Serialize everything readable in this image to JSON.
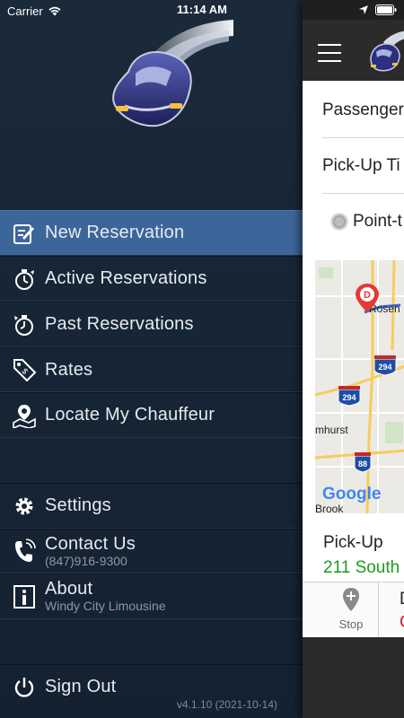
{
  "status_bar": {
    "carrier": "Carrier",
    "time": "11:14 AM"
  },
  "drawer": {
    "menu": [
      {
        "label": "New Reservation",
        "icon": "new-reservation-icon",
        "active": true
      },
      {
        "label": "Active Reservations",
        "icon": "stopwatch-icon"
      },
      {
        "label": "Past Reservations",
        "icon": "history-icon"
      },
      {
        "label": "Rates",
        "icon": "price-tag-icon"
      },
      {
        "label": "Locate My Chauffeur",
        "icon": "map-pin-icon"
      }
    ],
    "settings": {
      "label": "Settings",
      "icon": "gear-icon"
    },
    "contact": {
      "label": "Contact Us",
      "sub": "(847)916-9300",
      "icon": "phone-icon"
    },
    "about": {
      "label": "About",
      "sub": "Windy City Limousine",
      "icon": "info-icon"
    },
    "sign_out": {
      "label": "Sign Out",
      "icon": "power-icon"
    },
    "version": "v4.1.10 (2021-10-14)"
  },
  "main": {
    "field_passenger": "Passenger",
    "field_pickup_time": "Pick-Up Ti",
    "radio_label": "Point-t",
    "map": {
      "marker_letter": "D",
      "labels": [
        "Rosen",
        "mhurst",
        "Brook"
      ],
      "shields": [
        "294",
        "294",
        "88"
      ],
      "attribution": "Google"
    },
    "pickup_label": "Pick-Up",
    "pickup_address": "211 South",
    "stop_label": "Stop",
    "d_top": "D",
    "d_bottom": "C"
  },
  "colors": {
    "accent": "#3c6699",
    "drawer_bg": "#172636",
    "pickup_green": "#1f9a1f",
    "alert_red": "#d42020"
  }
}
